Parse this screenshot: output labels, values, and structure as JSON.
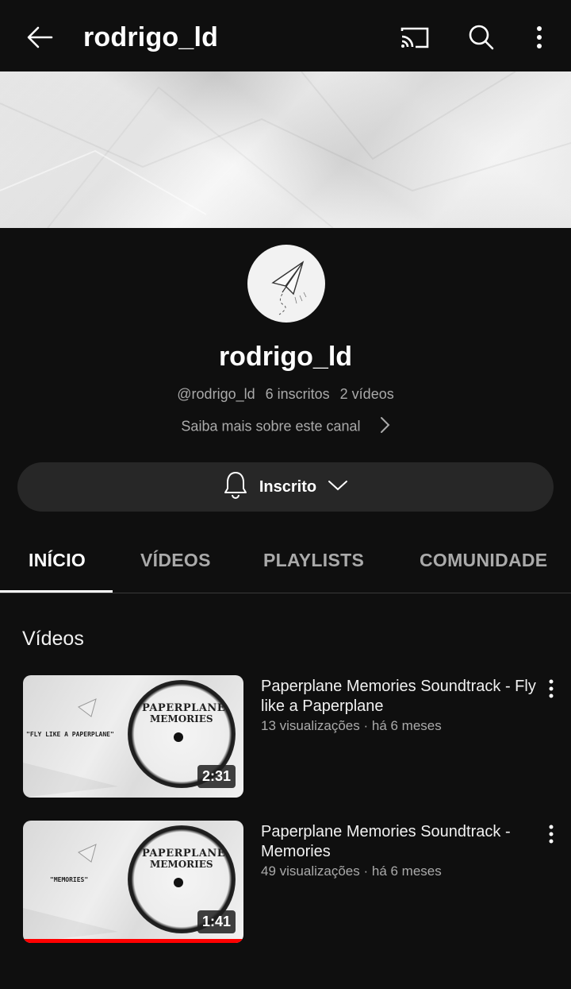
{
  "topbar": {
    "title": "rodrigo_ld",
    "icons": [
      "back-arrow-icon",
      "cast-icon",
      "search-icon",
      "more-vert-icon"
    ]
  },
  "channel": {
    "name": "rodrigo_ld",
    "handle": "@rodrigo_ld",
    "subscribers": "6 inscritos",
    "videos_count": "2 vídeos",
    "about_link": "Saiba mais sobre este canal"
  },
  "subscribe_button": {
    "label": "Inscrito",
    "icons": [
      "bell-icon",
      "chevron-down-icon"
    ]
  },
  "tabs": [
    {
      "label": "INÍCIO",
      "active": true
    },
    {
      "label": "VÍDEOS",
      "active": false
    },
    {
      "label": "PLAYLISTS",
      "active": false
    },
    {
      "label": "COMUNIDADE",
      "active": false
    }
  ],
  "section": {
    "title": "Vídeos"
  },
  "videos": [
    {
      "title": "Paperplane Memories Soundtrack - Fly like a Paperplane",
      "views": "13 visualizações",
      "age": "há 6 meses",
      "duration": "2:31",
      "thumb_title_line1": "PAPERPLANE",
      "thumb_title_line2": "MEMORIES",
      "thumb_caption": "\"FLY LIKE A PAPERPLANE\"",
      "watched_fraction": 0
    },
    {
      "title": "Paperplane Memories Soundtrack - Memories",
      "views": "49 visualizações",
      "age": "há 6 meses",
      "duration": "1:41",
      "thumb_title_line1": "PAPERPLANE",
      "thumb_title_line2": "MEMORIES",
      "thumb_caption": "\"MEMORIES\"",
      "watched_fraction": 1.0
    }
  ],
  "colors": {
    "background": "#0f0f0f",
    "accent": "#ff0000",
    "secondary_text": "#aaaaaa"
  }
}
